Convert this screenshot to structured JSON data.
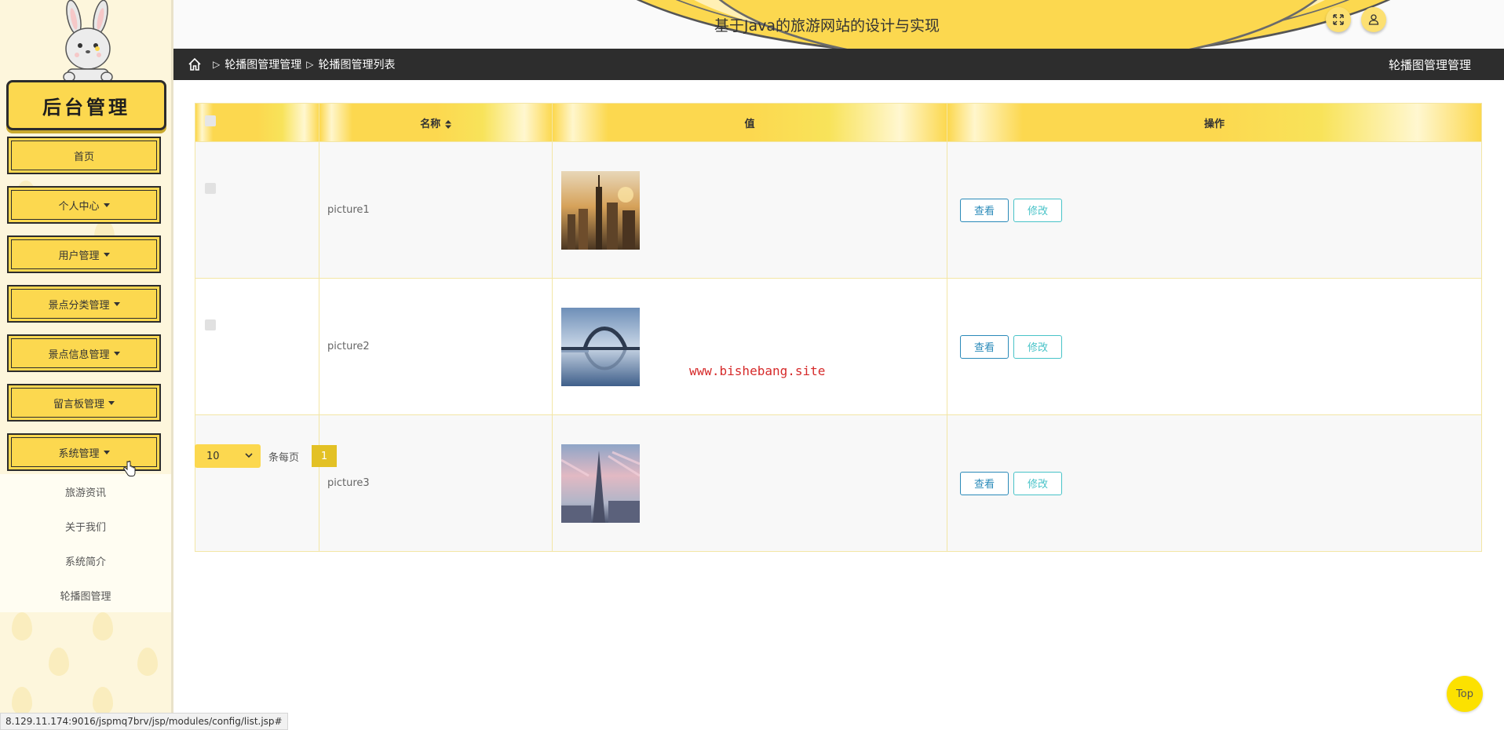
{
  "sidebar": {
    "logo_text": "后台管理",
    "menu": [
      {
        "label": "首页",
        "has_caret": false
      },
      {
        "label": "个人中心",
        "has_caret": true
      },
      {
        "label": "用户管理",
        "has_caret": true
      },
      {
        "label": "景点分类管理",
        "has_caret": true
      },
      {
        "label": "景点信息管理",
        "has_caret": true
      },
      {
        "label": "留言板管理",
        "has_caret": true
      },
      {
        "label": "系统管理",
        "has_caret": true
      }
    ],
    "submenu": [
      "旅游资讯",
      "关于我们",
      "系统简介",
      "轮播图管理"
    ]
  },
  "header": {
    "title": "基于Java的旅游网站的设计与实现",
    "fullscreen_icon": "expand-icon",
    "user_icon": "user-icon"
  },
  "breadcrumb": {
    "home_icon": "home-icon",
    "items": [
      "轮播图管理管理",
      "轮播图管理列表"
    ],
    "right_title": "轮播图管理管理"
  },
  "table": {
    "columns": [
      "名称",
      "值",
      "操作"
    ],
    "rows": [
      {
        "name": "picture1",
        "image": "city-sunset-thumbnail"
      },
      {
        "name": "picture2",
        "image": "bridge-lake-thumbnail"
      },
      {
        "name": "picture3",
        "image": "tower-sky-thumbnail"
      }
    ],
    "view_label": "查看",
    "edit_label": "修改"
  },
  "pagination": {
    "page_size": "10",
    "per_page_label": "条每页",
    "current_page": "1"
  },
  "watermark": "www.bishebang.site",
  "top_button": "Top",
  "status_url": "8.129.11.174:9016/jspmq7brv/jsp/modules/config/list.jsp#",
  "colors": {
    "accent": "#fcd84f",
    "header_bar": "#2d2d2d",
    "view_btn": "#2a8ab9",
    "edit_btn": "#48c3c8",
    "page_active": "#e3c125"
  }
}
